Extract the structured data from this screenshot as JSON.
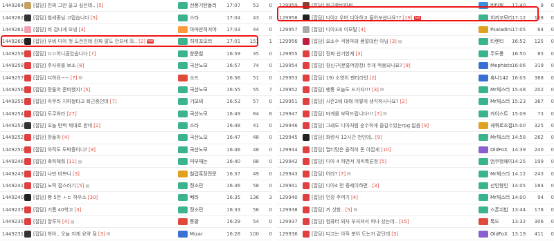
{
  "left_board": {
    "rows": [
      {
        "id": "1449264",
        "title": "[잡담] 진짜 그만 울고 싶은데..",
        "count": "[5]",
        "attach": "",
        "hot": "",
        "author": "선풍기탄돌리",
        "time": "17:07",
        "views": "53",
        "rec": "0",
        "icon": "#c8a060",
        "lv": "#3bb38f"
      },
      {
        "id": "1449262",
        "title": "[잡담] 힘세종님 고맙습니다",
        "count": "[5]",
        "attach": "",
        "hot": "",
        "author": "스타",
        "time": "17:04",
        "views": "43",
        "rec": "0",
        "icon": "#333333",
        "lv": "#3bb38f"
      },
      {
        "id": "1449261",
        "title": "[잡담] 비 겁나게 오넹",
        "count": "[3]",
        "attach": "",
        "hot": "",
        "author": "아마만히거야",
        "time": "17:03",
        "views": "44",
        "rec": "0",
        "icon": "#f2a0b0",
        "lv": "#ff9a3c"
      },
      {
        "id": "1449260",
        "title": "[잡담] 우비 디아 첫 도전인데 진짜 말도 안되네 와..",
        "count": "[2]",
        "attach": "",
        "hot": "hot",
        "author": "히끼꼬모리",
        "time": "17:01",
        "views": "151",
        "rec": "1",
        "icon": "#222222",
        "lv": "#3bb38f"
      },
      {
        "id": "1449259",
        "title": "[잡담] ㅁㅇ어니곰았습니다",
        "count": "[7]",
        "attach": "",
        "hot": "",
        "author": "항문철",
        "time": "16:59",
        "views": "35",
        "rec": "0",
        "icon": "#e04040",
        "lv": "#3bb38f"
      },
      {
        "id": "1449258",
        "title": "[잡담] 주사위를 보소",
        "count": "[8]",
        "attach": "",
        "hot": "",
        "author": "국산노모",
        "time": "16:57",
        "views": "74",
        "rec": "0",
        "icon": "#e04040",
        "lv": "#3bb38f"
      },
      {
        "id": "1449257",
        "title": "[잡담] 디하요~~",
        "count": "[7]",
        "attach": "▤",
        "hot": "",
        "author": "소드",
        "time": "16:56",
        "views": "51",
        "rec": "0",
        "icon": "#e04040",
        "lv": "#e04a3c"
      },
      {
        "id": "1449256",
        "title": "[잡담] 망들어 준비했지!",
        "count": "[5]",
        "attach": "",
        "hot": "",
        "author": "국산노모",
        "time": "16:55",
        "views": "55",
        "rec": "7",
        "icon": "#e04040",
        "lv": "#3bb38f"
      },
      {
        "id": "1449255",
        "title": "[잡담] 아무라 지하철타고 퇴근중인데",
        "count": "[7]",
        "attach": "",
        "hot": "",
        "author": "기모찌",
        "time": "16:53",
        "views": "57",
        "rec": "0",
        "icon": "#e04040",
        "lv": "#3bb38f"
      },
      {
        "id": "1449254",
        "title": "[잡담] 도쿠와라",
        "count": "[27]",
        "attach": "",
        "hot": "",
        "author": "국산노모",
        "time": "16:49",
        "views": "84",
        "rec": "6",
        "icon": "#e04040",
        "lv": "#3bb38f"
      },
      {
        "id": "1449253",
        "title": "[잡담] 오늘 탄력 제대로 받네",
        "count": "[2]",
        "attach": "",
        "hot": "",
        "author": "스타",
        "time": "16:48",
        "views": "41",
        "rec": "0",
        "icon": "#333333",
        "lv": "#3bb38f"
      },
      {
        "id": "1449252",
        "title": "[잡담] 망들아",
        "count": "[4]",
        "attach": "",
        "hot": "",
        "author": "국산노모",
        "time": "16:47",
        "views": "48",
        "rec": "0",
        "icon": "#e04040",
        "lv": "#3bb38f"
      },
      {
        "id": "1449250",
        "title": "[잡담] 아직도 도박중이니?",
        "count": "[9]",
        "attach": "",
        "hot": "",
        "author": "국산노모",
        "time": "16:46",
        "views": "48",
        "rec": "0",
        "icon": "#e04040",
        "lv": "#3bb38f"
      },
      {
        "id": "1449246",
        "title": "[잡담] 축하해줘",
        "count": "[11]",
        "attach": "▤",
        "hot": "",
        "author": "피부재는",
        "time": "16:40",
        "views": "88",
        "rec": "0",
        "icon": "#e04040",
        "lv": "#3bb38f"
      },
      {
        "id": "1449243",
        "title": "[잡담] 나만 비쁘니",
        "count": "[3]",
        "attach": "",
        "hot": "",
        "author": "철갑흑장전문",
        "time": "16:37",
        "views": "49",
        "rec": "0",
        "icon": "#e04040",
        "lv": "#e0a020"
      },
      {
        "id": "1449241",
        "title": "[잡담] 노딱 잡스러기",
        "count": "[5]",
        "attach": "▤",
        "hot": "",
        "author": "정소민",
        "time": "16:36",
        "views": "58",
        "rec": "0",
        "icon": "#e04040",
        "lv": "#3bb38f"
      },
      {
        "id": "1449240",
        "title": "[잡담] 빵 5천 ㅅㄷ 하우스",
        "count": "[30]",
        "attach": "",
        "hot": "",
        "author": "베라",
        "time": "16:35",
        "views": "136",
        "rec": "3",
        "icon": "#222222",
        "lv": "#3bb38f"
      },
      {
        "id": "1449237",
        "title": "[잡담] 기름 40학고",
        "count": "[3]",
        "attach": "",
        "hot": "",
        "author": "정소민",
        "time": "16:33",
        "views": "56",
        "rec": "0",
        "icon": "#e04040",
        "lv": "#3bb38f"
      },
      {
        "id": "1449235",
        "title": "[잡담] 할루처",
        "count": "[4]",
        "attach": "▤",
        "hot": "",
        "author": "통황",
        "time": "16:29",
        "views": "54",
        "rec": "0",
        "icon": "#e04040",
        "lv": "#e04a3c"
      },
      {
        "id": "1449231",
        "title": "[잡담] 하아.. 오늘 자게 요약 점",
        "count": "[3]",
        "attach": "▤",
        "hot": "",
        "author": "Mizar",
        "time": "16:28",
        "views": "100",
        "rec": "0",
        "icon": "#333333",
        "lv": "#3b6fd3"
      }
    ]
  },
  "right_board": {
    "rows": [
      {
        "id": "129959",
        "title": "[잡담] 퇴근중비하세",
        "count": "",
        "attach": "",
        "hot": "",
        "author": "비타힘",
        "time": "17:40",
        "views": "8",
        "rec": "0",
        "icon": "#8a4030",
        "lv": "#3b8fe0"
      },
      {
        "id": "129958",
        "title": "[잡담] 디아2 우버 디아하고 들어보셨나요??",
        "count": "[19]",
        "attach": "",
        "hot": "hot",
        "author": "히끼꼬모리",
        "time": "17:12",
        "views": "158",
        "rec": "0",
        "icon": "#222222",
        "lv": "#3bb38f"
      },
      {
        "id": "129957",
        "title": "[잡담] 디아3과 이모탈",
        "count": "[4]",
        "attach": "",
        "hot": "",
        "author": "Psaladina",
        "time": "17:05",
        "views": "64",
        "rec": "0",
        "icon": "#aaaaaa",
        "lv": "#e0a020"
      },
      {
        "id": "129956",
        "title": "[잡담] 요소수 걱정마래 품절대란 아님",
        "count": "[3]",
        "attach": "▤",
        "hot": "",
        "author": "티렌티",
        "time": "16:52",
        "views": "125",
        "rec": "0",
        "icon": "#c02040",
        "lv": "#3bb38f"
      },
      {
        "id": "129955",
        "title": "[잡담] 진짜 신기한게",
        "count": "[3]",
        "attach": "",
        "hot": "",
        "author": "주도롱",
        "time": "16:50",
        "views": "85",
        "rec": "0",
        "icon": "#e04040",
        "lv": "#3bb38f"
      },
      {
        "id": "129954",
        "title": "[잡담] 장신구(분홍머장장) 두게 적용되나요?",
        "count": "[9]",
        "attach": "",
        "hot": "",
        "author": "Mephisto1",
        "time": "16:06",
        "views": "319",
        "rec": "0",
        "icon": "#e04040",
        "lv": "#3b6fd3"
      },
      {
        "id": "129953",
        "title": "[잡담] 19) 소영이 팬티라인",
        "count": "[2]",
        "attach": "",
        "hot": "",
        "author": "휴니142",
        "time": "16:03",
        "views": "388",
        "rec": "0",
        "icon": "#e04040",
        "lv": "#3b6fd3"
      },
      {
        "id": "129952",
        "title": "[잡담] 팽통 오늘도 드가자!!!",
        "count": "[3]",
        "attach": "▤",
        "hot": "",
        "author": "Mr체스터",
        "time": "15:48",
        "views": "202",
        "rec": "0",
        "icon": "#e04040",
        "lv": "#3bb38f"
      },
      {
        "id": "129951",
        "title": "[잡담] 시즌2에 대해 어떻게 생각하시나요?",
        "count": "[2]",
        "attach": "",
        "hot": "",
        "author": "Mr체스터",
        "time": "15:23",
        "views": "367",
        "rec": "0",
        "icon": "#e04040",
        "lv": "#3bb38f"
      },
      {
        "id": "129947",
        "title": "[잡담] 마계를 부탁드립니다!!!",
        "count": "[7]",
        "attach": "▤",
        "hot": "",
        "author": "카이스트",
        "time": "15:09",
        "views": "73",
        "rec": "0",
        "icon": "#e04040",
        "lv": "#3bb38f"
      },
      {
        "id": "129946",
        "title": "[잡담] 그래도 디아처럼 순수하게 즐길수있는rpg 없음",
        "count": "[9]",
        "attach": "",
        "hot": "",
        "author": "궤쿼로조잡",
        "time": "15:00",
        "views": "325",
        "rec": "0",
        "icon": "#e04040",
        "lv": "#e0a020"
      },
      {
        "id": "129945",
        "title": "[잡담] 화령식 12시간 천인데..",
        "count": "[9]",
        "attach": "",
        "hot": "",
        "author": "Mr체스터",
        "time": "14:58",
        "views": "262",
        "rec": "0",
        "icon": "#222222",
        "lv": "#3bb38f"
      },
      {
        "id": "129944",
        "title": "[잡담] 열티맛은 을직히 돈 아깝게",
        "count": "[10]",
        "attach": "",
        "hot": "",
        "author": "OldFoX",
        "time": "14:39",
        "views": "240",
        "rec": "0",
        "icon": "#e04040",
        "lv": "#8a5fd0"
      },
      {
        "id": "129942",
        "title": "[잡담] 디아 4 하면서 개미특론정",
        "count": "[5]",
        "attach": "",
        "hot": "",
        "author": "엄쿠정에이스",
        "time": "14:25",
        "views": "199",
        "rec": "0",
        "icon": "#e04040",
        "lv": "#3bb38f"
      },
      {
        "id": "129943",
        "title": "[잡담] 어라?",
        "count": "[7]",
        "attach": "▤",
        "hot": "",
        "author": "Mr체스터",
        "time": "14:12",
        "views": "243",
        "rec": "0",
        "icon": "#e04040",
        "lv": "#3bb38f"
      },
      {
        "id": "129941",
        "title": "[잡담] 디아4 먼 중레이하면..",
        "count": "[3]",
        "attach": "",
        "hot": "",
        "author": "선인형인",
        "time": "14:05",
        "views": "184",
        "rec": "0",
        "icon": "#e04040",
        "lv": "#3bb38f"
      },
      {
        "id": "129940",
        "title": "[잡담] 인장 주머기",
        "count": "[4]",
        "attach": "",
        "hot": "",
        "author": "Mr체스터",
        "time": "14:00",
        "views": "94",
        "rec": "0",
        "icon": "#e04040",
        "lv": "#3bb38f"
      },
      {
        "id": "129938",
        "title": "[잡담] 끼 삿항..",
        "count": "[5]",
        "attach": "▤",
        "hot": "",
        "author": "스폰쉬밥",
        "time": "13:44",
        "views": "178",
        "rec": "0",
        "icon": "#e04040",
        "lv": "#3bb38f"
      },
      {
        "id": "129937",
        "title": "[잡담] 컴퓨터 외자 부셔져서 하나 샀는데..",
        "count": "[15]",
        "attach": "",
        "hot": "",
        "author": "톡드",
        "time": "13:32",
        "views": "306",
        "rec": "0",
        "icon": "#e04040",
        "lv": "#e04a3c"
      },
      {
        "id": "129936",
        "title": "[잡담] 디고는 아직 분이 도는거 같던데",
        "count": "[3]",
        "attach": "",
        "hot": "",
        "author": "OldFoX",
        "time": "13:19",
        "views": "411",
        "rec": "0",
        "icon": "#e04040",
        "lv": "#8a5fd0"
      }
    ]
  },
  "highlights": {
    "left_row": 3,
    "right_row": 1
  }
}
